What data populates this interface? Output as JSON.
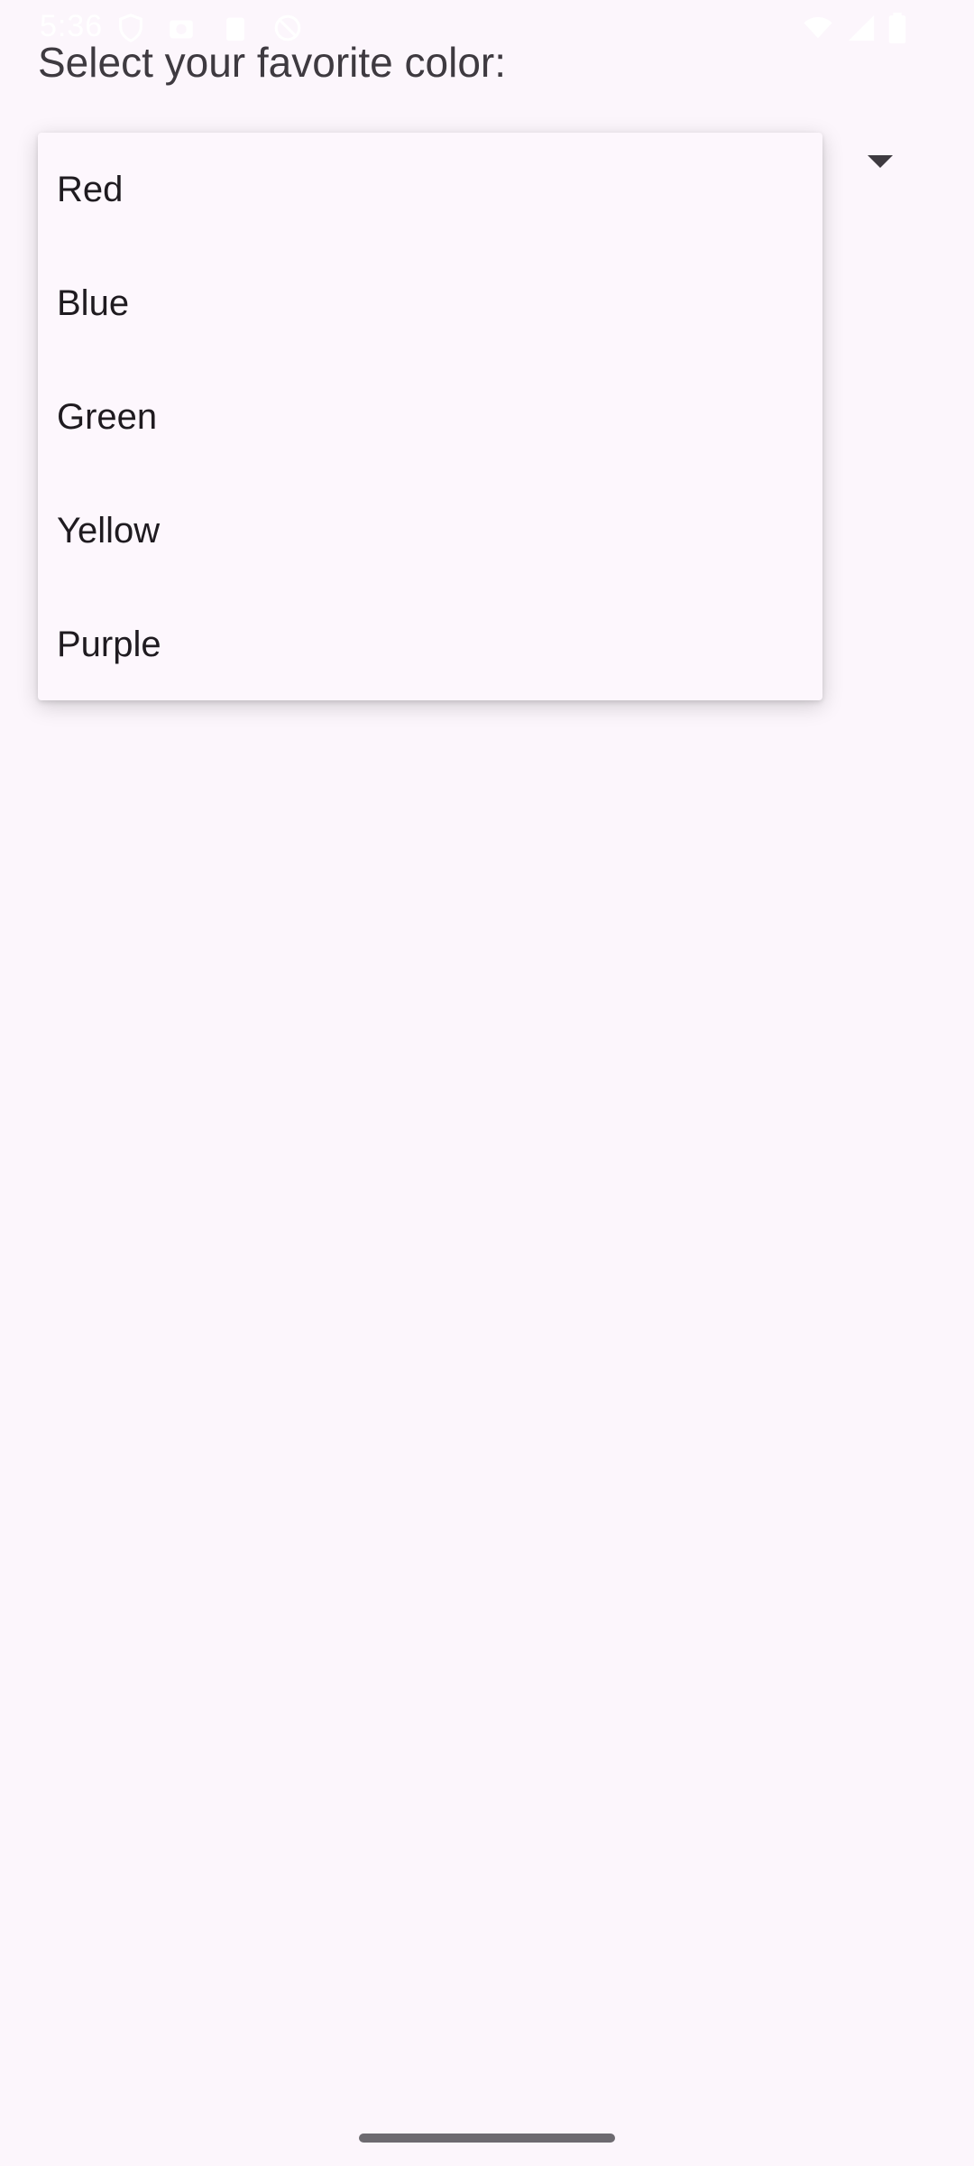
{
  "status_bar": {
    "time": "5:36",
    "left_icons": [
      "shield-icon",
      "camera-icon",
      "clipboard-icon",
      "do-not-disturb-icon"
    ],
    "right_icons": [
      "wifi-icon",
      "signal-icon",
      "battery-icon"
    ]
  },
  "page": {
    "prompt": "Select your favorite color:"
  },
  "spinner": {
    "options": [
      "Red",
      "Blue",
      "Green",
      "Yellow",
      "Purple"
    ]
  },
  "colors": {
    "background": "#fcf6fc",
    "menu_surface": "#fdf7fd",
    "text": "#1f1b20"
  }
}
